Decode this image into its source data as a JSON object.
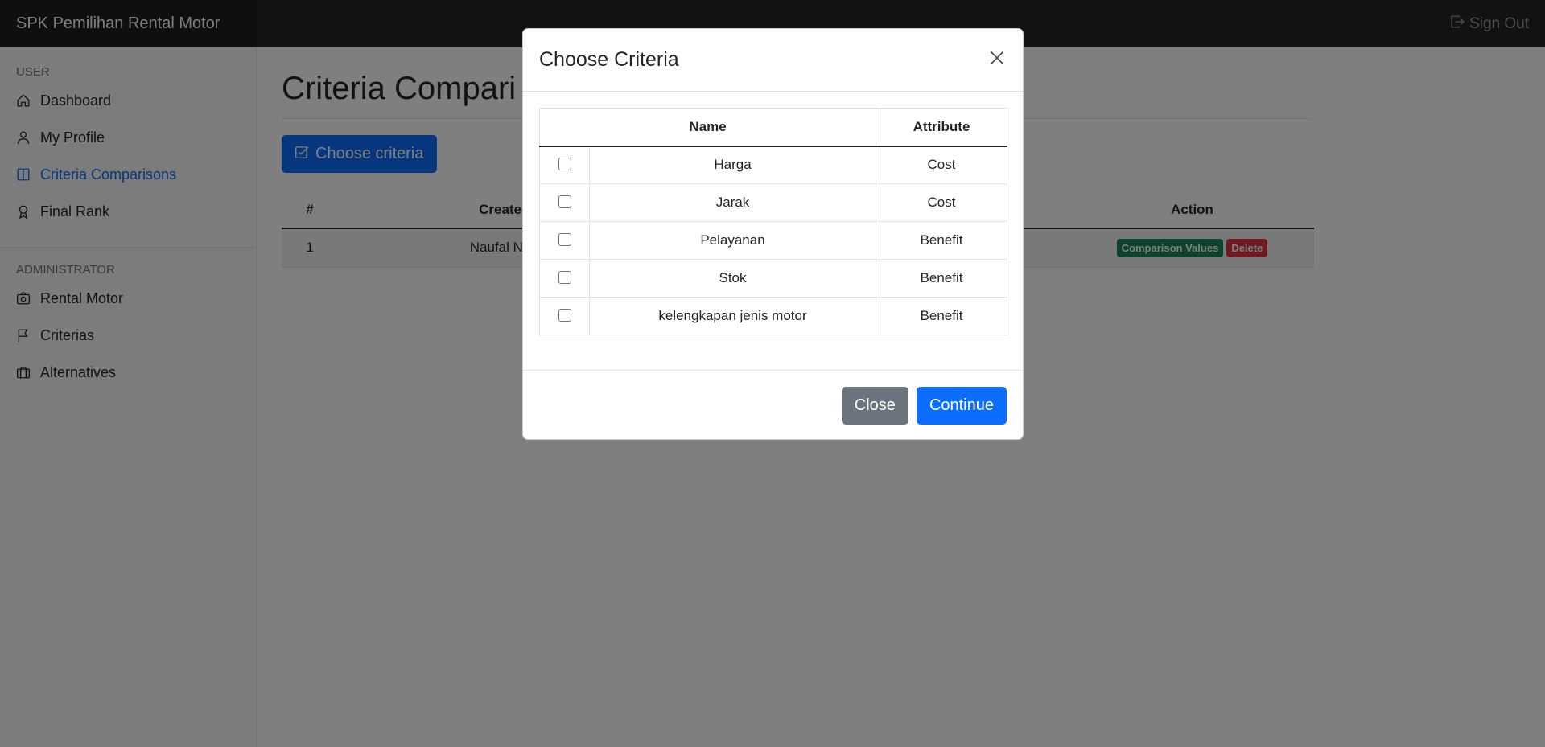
{
  "navbar": {
    "brand": "SPK Pemilihan Rental Motor",
    "signout_label": "Sign Out"
  },
  "sidebar": {
    "user_heading": "USER",
    "user_items": [
      {
        "label": "Dashboard",
        "icon": "house-icon"
      },
      {
        "label": "My Profile",
        "icon": "person-icon"
      },
      {
        "label": "Criteria Comparisons",
        "icon": "layout-split-icon",
        "active": true
      },
      {
        "label": "Final Rank",
        "icon": "award-icon"
      }
    ],
    "admin_heading": "ADMINISTRATOR",
    "admin_items": [
      {
        "label": "Rental Motor",
        "icon": "camera-icon"
      },
      {
        "label": "Criterias",
        "icon": "flag-icon"
      },
      {
        "label": "Alternatives",
        "icon": "briefcase-icon"
      }
    ]
  },
  "main": {
    "title": "Criteria Compari",
    "choose_button": "Choose criteria",
    "table": {
      "headers": [
        "#",
        "Created By",
        "Action"
      ],
      "row": {
        "num": "1",
        "created_by": "Naufal Najmud",
        "action_badges": [
          "Comparison Values",
          "Delete"
        ]
      }
    }
  },
  "modal": {
    "title": "Choose Criteria",
    "headers": [
      "Name",
      "Attribute"
    ],
    "rows": [
      {
        "name": "Harga",
        "attribute": "Cost"
      },
      {
        "name": "Jarak",
        "attribute": "Cost"
      },
      {
        "name": "Pelayanan",
        "attribute": "Benefit"
      },
      {
        "name": "Stok",
        "attribute": "Benefit"
      },
      {
        "name": "kelengkapan jenis motor",
        "attribute": "Benefit"
      }
    ],
    "close_label": "Close",
    "continue_label": "Continue"
  },
  "colors": {
    "primary": "#0d6efd",
    "secondary": "#6c757d",
    "success": "#198754",
    "danger": "#dc3545",
    "navbar": "#212529"
  }
}
